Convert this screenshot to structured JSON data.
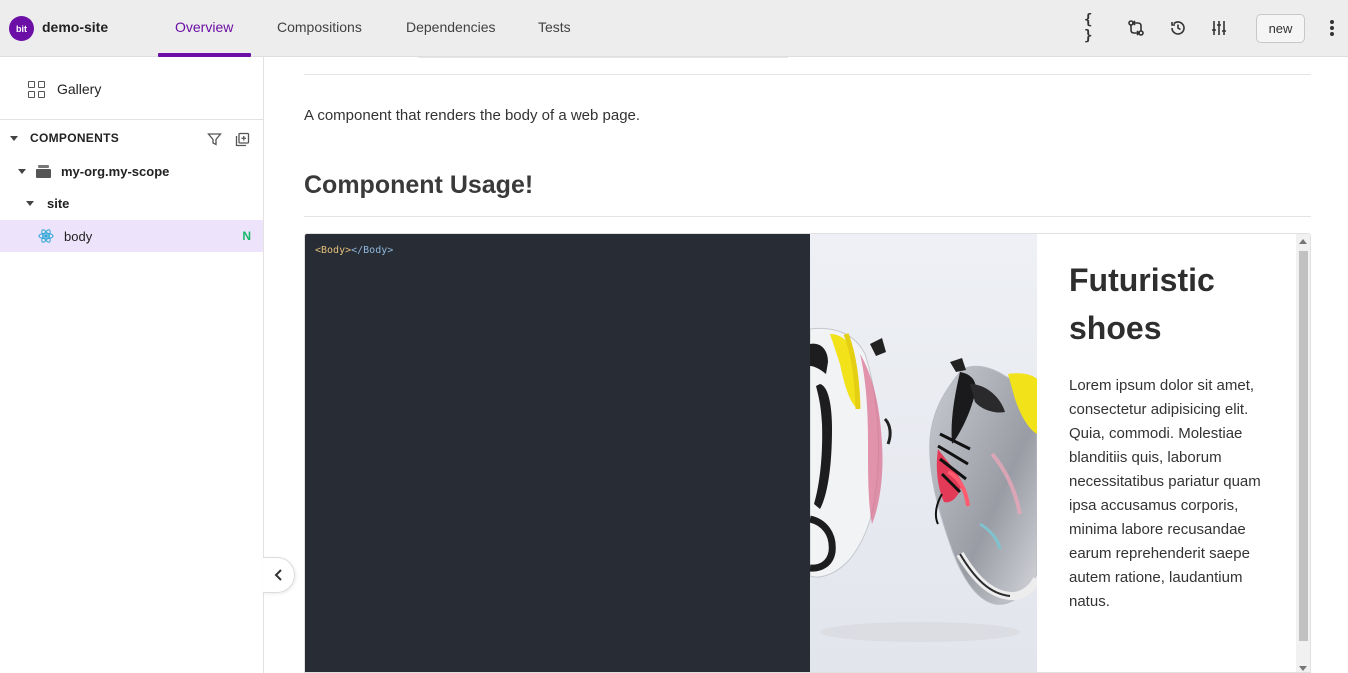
{
  "header": {
    "logo_text": "bit",
    "site_name": "demo-site",
    "tabs": [
      {
        "label": "Overview",
        "active": true
      },
      {
        "label": "Compositions",
        "active": false
      },
      {
        "label": "Dependencies",
        "active": false
      },
      {
        "label": "Tests",
        "active": false
      }
    ],
    "toolbar_icons": [
      "code-braces-icon",
      "compare-icon",
      "history-icon",
      "sliders-icon"
    ],
    "new_button": "new",
    "accent_color": "#6c0fa6"
  },
  "sidebar": {
    "gallery_label": "Gallery",
    "components_header": "COMPONENTS",
    "tree": {
      "scope": "my-org.my-scope",
      "namespace": "site",
      "component": "body",
      "component_status": "N"
    },
    "selected_color": "#ede3fa"
  },
  "main": {
    "description": "A component that renders the body of a web page.",
    "usage_heading": "Component Usage!",
    "code": {
      "open_tag": "<Body>",
      "close_tag": "</Body>"
    },
    "preview": {
      "title": "Futuristic shoes",
      "body": "Lorem ipsum dolor sit amet, consectetur adipisicing elit. Quia, commodi. Molestiae blanditiis quis, laborum necessitatibus pariatur quam ipsa accusamus corporis, minima labore recusandae earum reprehenderit saepe autem ratione, laudantium natus."
    }
  }
}
